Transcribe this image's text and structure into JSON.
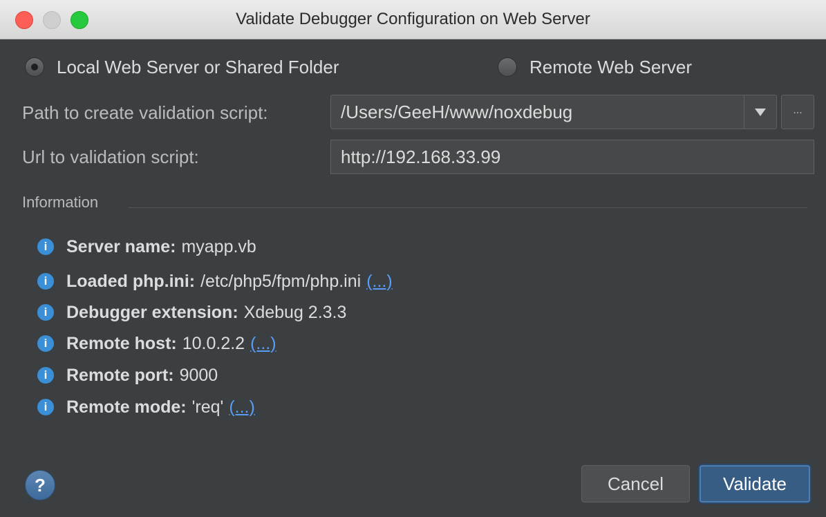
{
  "window": {
    "title": "Validate Debugger Configuration on Web Server"
  },
  "mode": {
    "local_label": "Local Web Server or Shared Folder",
    "local_selected": true,
    "remote_label": "Remote Web Server",
    "remote_selected": false
  },
  "form": {
    "path_label": "Path to create validation script:",
    "path_value": "/Users/GeeH/www/noxdebug",
    "browse_label": "...",
    "url_label": "Url to validation script:",
    "url_value": "http://192.168.33.99"
  },
  "information": {
    "title": "Information",
    "icon": "info-icon",
    "items": [
      {
        "key": "Server name:",
        "value": "myapp.vb",
        "link": ""
      },
      {
        "key": "Loaded php.ini:",
        "value": "/etc/php5/fpm/php.ini",
        "link": "(...)"
      },
      {
        "key": "Debugger extension:",
        "value": "Xdebug 2.3.3",
        "link": ""
      },
      {
        "key": "Remote host:",
        "value": "10.0.2.2",
        "link": "(...)"
      },
      {
        "key": "Remote port:",
        "value": "9000",
        "link": ""
      },
      {
        "key": "Remote mode:",
        "value": "'req'",
        "link": "(...)"
      }
    ]
  },
  "footer": {
    "help_label": "?",
    "cancel_label": "Cancel",
    "validate_label": "Validate"
  },
  "colors": {
    "background": "#3c3f41",
    "accent": "#375d85",
    "link": "#589df6",
    "info_icon": "#3a8fd6"
  }
}
